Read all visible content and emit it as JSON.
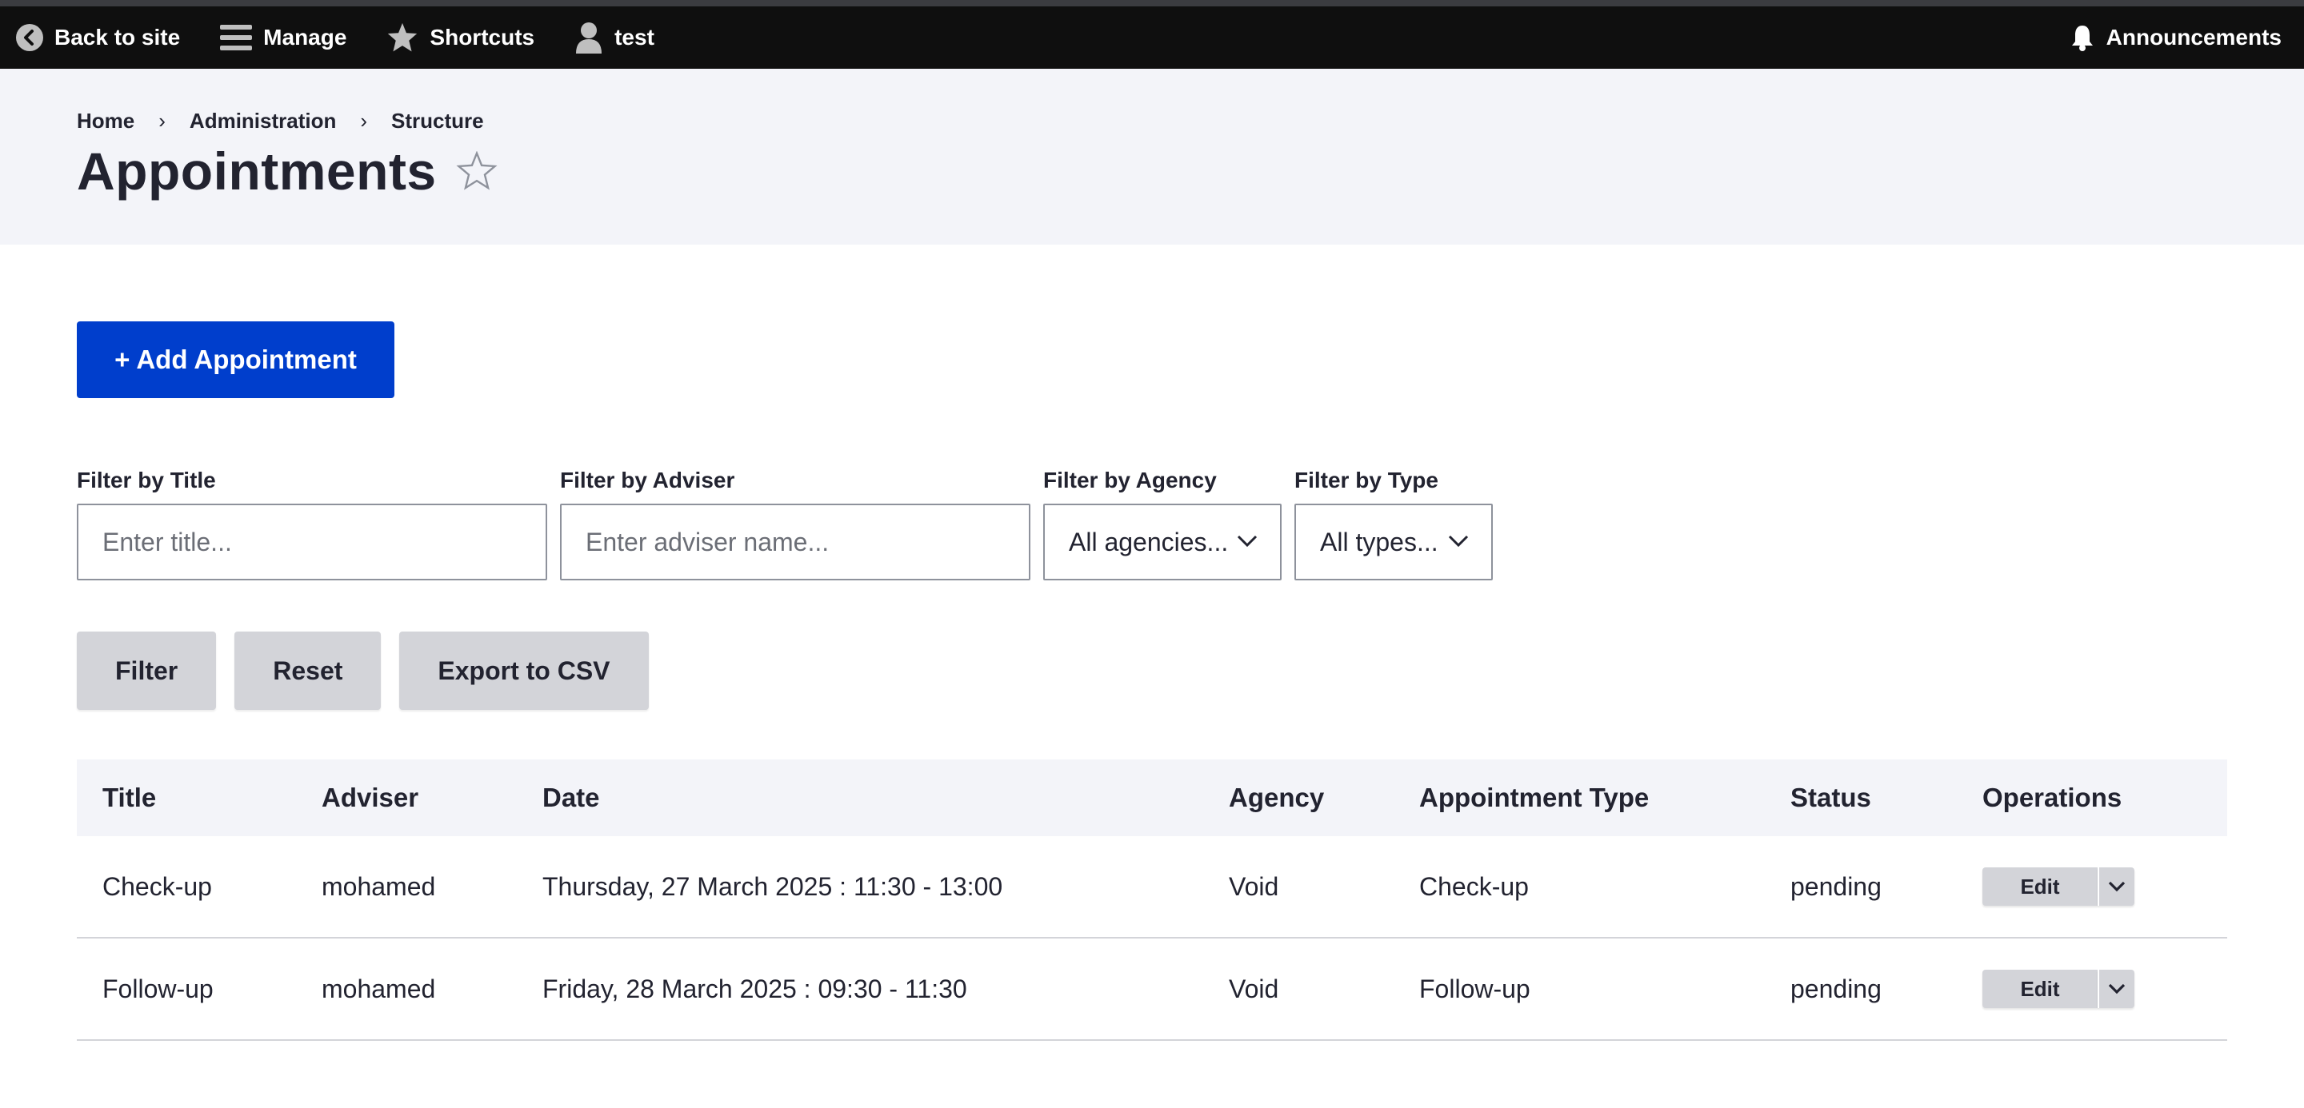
{
  "toolbar": {
    "back_label": "Back to site",
    "manage_label": "Manage",
    "shortcuts_label": "Shortcuts",
    "user_label": "test",
    "announcements_label": "Announcements"
  },
  "breadcrumb": [
    "Home",
    "Administration",
    "Structure"
  ],
  "breadcrumb_separator": "›",
  "page_title": "Appointments",
  "add_button_label": "+ Add Appointment",
  "filters": {
    "title": {
      "label": "Filter by Title",
      "placeholder": "Enter title..."
    },
    "adviser": {
      "label": "Filter by Adviser",
      "placeholder": "Enter adviser name..."
    },
    "agency": {
      "label": "Filter by Agency",
      "selected": "All agencies..."
    },
    "type": {
      "label": "Filter by Type",
      "selected": "All types..."
    }
  },
  "actions": {
    "filter_label": "Filter",
    "reset_label": "Reset",
    "export_label": "Export to CSV"
  },
  "table": {
    "headers": [
      "Title",
      "Adviser",
      "Date",
      "Agency",
      "Appointment Type",
      "Status",
      "Operations"
    ],
    "rows": [
      {
        "title": "Check-up",
        "adviser": "mohamed",
        "date": "Thursday, 27 March 2025 : 11:30 - 13:00",
        "agency": "Void",
        "type": "Check-up",
        "status": "pending",
        "op": "Edit"
      },
      {
        "title": "Follow-up",
        "adviser": "mohamed",
        "date": "Friday, 28 March 2025 : 09:30 - 11:30",
        "agency": "Void",
        "type": "Follow-up",
        "status": "pending",
        "op": "Edit"
      }
    ]
  },
  "colors": {
    "primary": "#003ecc",
    "toolbar_bg": "#0f0f0f",
    "header_bg": "#f3f4f9",
    "button_grey": "#d3d4d9"
  },
  "icons": [
    "back-arrow-icon",
    "hamburger-icon",
    "star-icon",
    "user-icon",
    "bell-icon",
    "star-outline-icon",
    "chevron-down-icon"
  ]
}
